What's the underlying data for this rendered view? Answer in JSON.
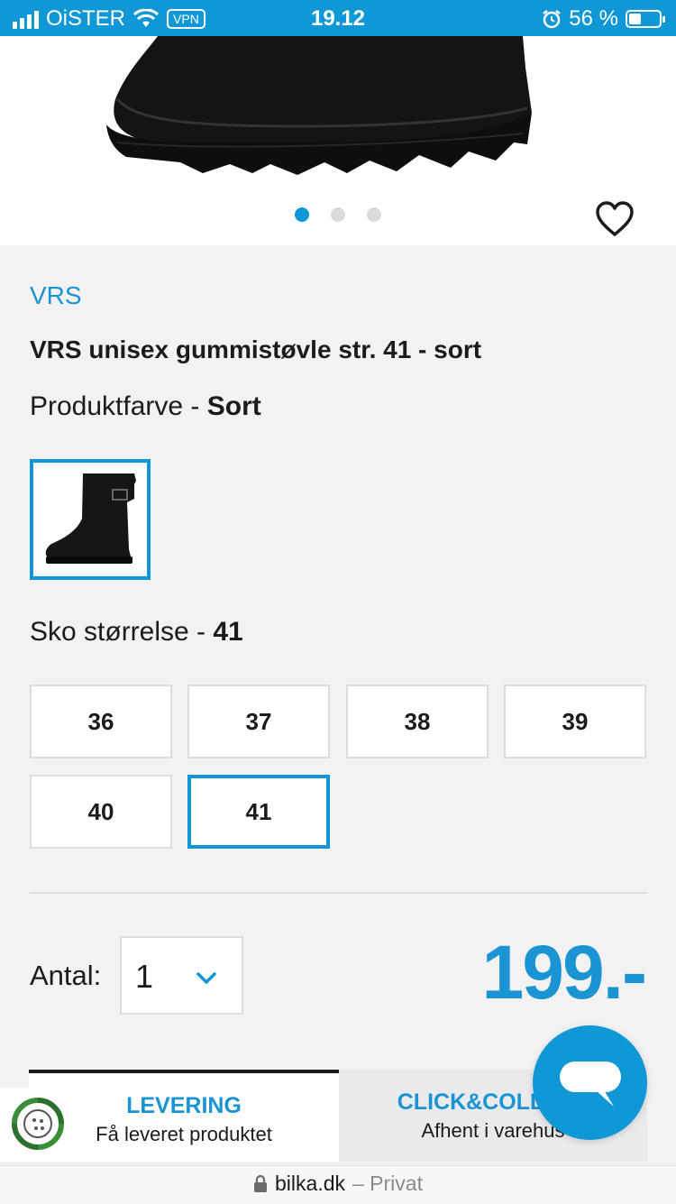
{
  "status_bar": {
    "carrier": "OiSTER",
    "vpn": "VPN",
    "time": "19.12",
    "battery_percent": "56 %",
    "battery_level": 0.56
  },
  "hero": {
    "carousel_count": 3,
    "active_index": 0
  },
  "product": {
    "brand": "VRS",
    "title": "VRS unisex gummistøvle str. 41 - sort",
    "color_label": "Produktfarve - ",
    "color_value": "Sort",
    "size_label": "Sko størrelse - ",
    "size_value": "41",
    "sizes": [
      "36",
      "37",
      "38",
      "39",
      "40",
      "41"
    ],
    "selected_size": "41"
  },
  "purchase": {
    "qty_label": "Antal:",
    "qty_value": "1",
    "price": "199.-"
  },
  "tabs": {
    "delivery_title": "LEVERING",
    "delivery_sub": "Få leveret produktet",
    "click_title": "CLICK&COLLECT",
    "click_sub": "Afhent i varehus"
  },
  "urlbar": {
    "domain": "bilka.dk",
    "mode": "– Privat"
  },
  "icons": [
    "wifi-icon",
    "alarm-icon",
    "heart-icon",
    "chevron-down-icon",
    "chat-icon",
    "lock-icon",
    "eco-badge-icon"
  ],
  "colors": {
    "accent": "#0f97d6",
    "text": "#1b1b1b"
  }
}
